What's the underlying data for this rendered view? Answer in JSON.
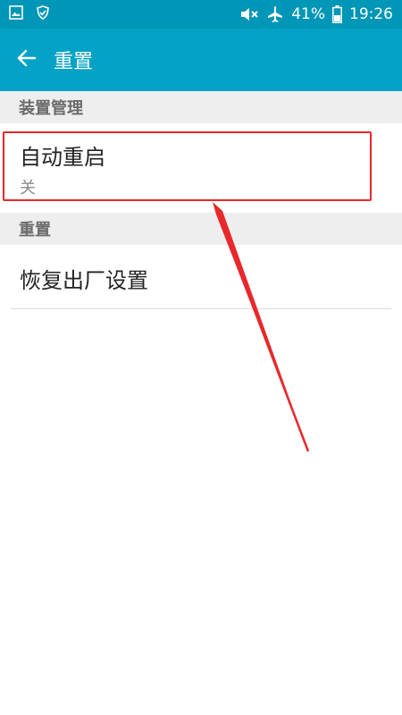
{
  "status_bar": {
    "battery_percent": "41%",
    "time": "19:26",
    "icons": [
      "gallery-icon",
      "shield-icon",
      "mute-icon",
      "airplane-icon",
      "battery-icon"
    ]
  },
  "app_bar": {
    "title": "重置",
    "back_icon": "back-arrow-icon"
  },
  "sections": [
    {
      "header": "装置管理",
      "items": [
        {
          "title": "自动重启",
          "summary": "关"
        }
      ]
    },
    {
      "header": "重置",
      "items": [
        {
          "title": "恢复出厂设置"
        }
      ]
    }
  ],
  "colors": {
    "status_bar": "#0096b7",
    "app_bar": "#03a2c6",
    "section_header_bg": "#eeeeee",
    "annotation": "#e8282b"
  }
}
